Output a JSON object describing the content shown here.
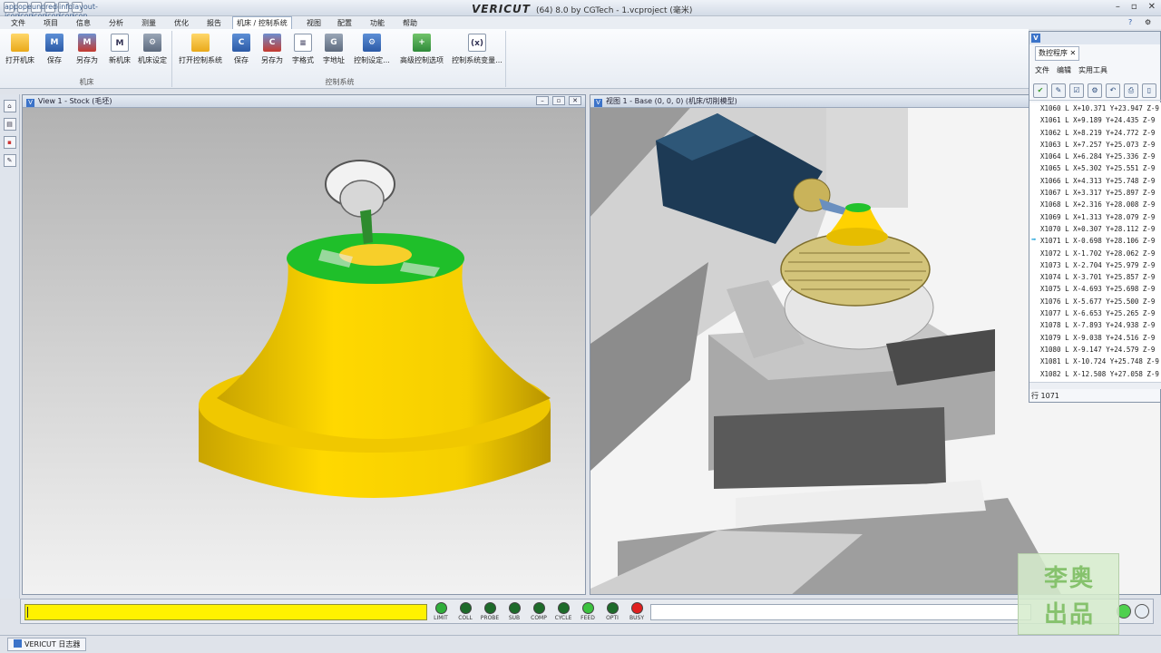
{
  "titlebar": {
    "brand": "VERICUT",
    "title": "(64) 8.0 by CGTech - 1.vcproject (毫米)",
    "quick_access_icons": [
      "app-icon",
      "open-icon",
      "undo-icon",
      "redo-icon",
      "info-icon",
      "layout-icon"
    ],
    "window_buttons": [
      "–",
      "▫",
      "✕"
    ]
  },
  "menubar": {
    "items": [
      "文件",
      "项目",
      "信息",
      "分析",
      "测量",
      "优化",
      "报告",
      "机床 / 控制系统",
      "视图",
      "配置",
      "功能",
      "帮助"
    ],
    "help_icons": [
      "?",
      "⚙"
    ]
  },
  "ribbon": {
    "groups": [
      {
        "caption": "机床",
        "buttons": [
          {
            "label": "打开机床",
            "icon": "folder-open-icon",
            "glyph": ""
          },
          {
            "label": "保存",
            "icon": "save-machine-icon",
            "glyph": "M"
          },
          {
            "label": "另存为",
            "icon": "save-as-machine-icon",
            "glyph": "M"
          },
          {
            "label": "新机床",
            "icon": "new-machine-icon",
            "glyph": "M"
          },
          {
            "label": "机床设定",
            "icon": "machine-settings-icon",
            "glyph": "⚙"
          }
        ]
      },
      {
        "caption": "控制系统",
        "buttons": [
          {
            "label": "打开控制系统",
            "icon": "folder-open-control-icon",
            "glyph": ""
          },
          {
            "label": "保存",
            "icon": "save-control-icon",
            "glyph": "C"
          },
          {
            "label": "另存为",
            "icon": "save-as-control-icon",
            "glyph": "C"
          },
          {
            "label": "字格式",
            "icon": "word-format-icon",
            "glyph": "≡"
          },
          {
            "label": "字地址",
            "icon": "word-address-icon",
            "glyph": "G"
          },
          {
            "label": "控制设定...",
            "icon": "control-settings-icon",
            "glyph": "⚙"
          },
          {
            "label": "高级控制选项",
            "icon": "advanced-control-icon",
            "glyph": "+"
          },
          {
            "label": "控制系统变量...",
            "icon": "control-variables-icon",
            "glyph": "(x)"
          }
        ]
      }
    ]
  },
  "left_strip": {
    "tools": [
      "⌂",
      "▤",
      "▪",
      "✎"
    ]
  },
  "views": {
    "left": {
      "title": "View 1 - Stock (毛坯)",
      "buttons": [
        "–",
        "▫",
        "✕"
      ]
    },
    "right": {
      "title": "视图 1 - Base (0, 0, 0) (机床/切削模型)"
    }
  },
  "nc_program": {
    "panel_title": "数控程序",
    "tab_close": "✕",
    "menu": [
      "文件",
      "编辑",
      "实用工具"
    ],
    "tools": [
      "✔",
      "✎",
      "☑",
      "⚙",
      "↶",
      "⎙",
      "▯"
    ],
    "lines": [
      "X1060 L X+10.371 Y+23.947 Z-9",
      "X1061 L X+9.189 Y+24.435 Z-9",
      "X1062 L X+8.219 Y+24.772 Z-9",
      "X1063 L X+7.257 Y+25.073 Z-9",
      "X1064 L X+6.284 Y+25.336 Z-9",
      "X1065 L X+5.302 Y+25.551 Z-9",
      "X1066 L X+4.313 Y+25.748 Z-9",
      "X1067 L X+3.317 Y+25.897 Z-9",
      "X1068 L X+2.316 Y+28.008 Z-9",
      "X1069 L X+1.313 Y+28.079 Z-9",
      "X1070 L X+0.307 Y+28.112 Z-9",
      "X1071 L X-0.698 Y+28.106 Z-9",
      "X1072 L X-1.702 Y+28.062 Z-9",
      "X1073 L X-2.704 Y+25.979 Z-9",
      "X1074 L X-3.701 Y+25.857 Z-9",
      "X1075 L X-4.693 Y+25.698 Z-9",
      "X1076 L X-5.677 Y+25.500 Z-9",
      "X1077 L X-6.653 Y+25.265 Z-9",
      "X1078 L X-7.893 Y+24.938 Z-9",
      "X1079 L X-9.038 Y+24.516 Z-9",
      "X1080 L X-9.147 Y+24.579 Z-9",
      "X1081 L X-10.724 Y+25.748 Z-9",
      "X1082 L X-12.508 Y+27.058 Z-9"
    ],
    "current_line_index": 11,
    "status": "行 1071"
  },
  "status_bar": {
    "leds": [
      {
        "label": "LIMIT",
        "color": "#2fae3a"
      },
      {
        "label": "COLL",
        "color": "#1d6b2a"
      },
      {
        "label": "PROBE",
        "color": "#1d6b2a"
      },
      {
        "label": "SUB",
        "color": "#1d6b2a"
      },
      {
        "label": "COMP",
        "color": "#1d6b2a"
      },
      {
        "label": "CYCLE",
        "color": "#1d6b2a"
      },
      {
        "label": "FEED",
        "color": "#3cc23f"
      },
      {
        "label": "OPTI",
        "color": "#1d6b2a"
      },
      {
        "label": "BUSY",
        "color": "#e02020"
      }
    ],
    "progress_color": "#fff200"
  },
  "watermark": {
    "line1": "李奥",
    "line2": "出品"
  },
  "taskbar": {
    "item": "VERICUT 日志器"
  }
}
